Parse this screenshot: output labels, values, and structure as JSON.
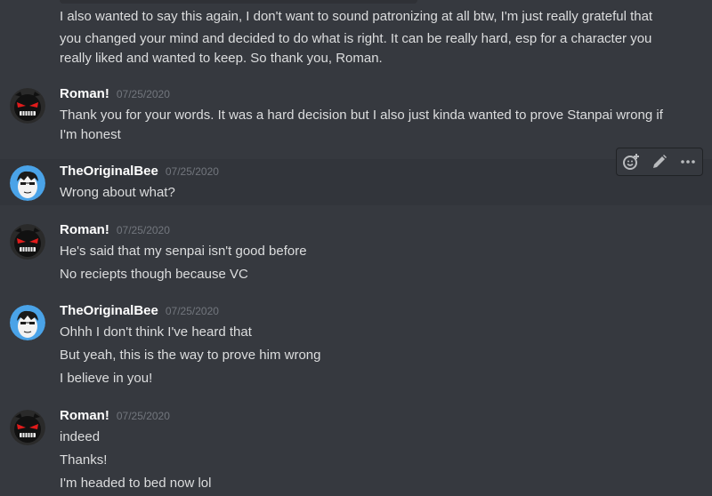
{
  "continuation_lines": [
    "I also wanted to say this again, I don't want to sound patronizing at all btw, I'm just really grateful that",
    "you changed your mind and decided to do what is right. It can be really hard, esp for a character you",
    "really liked and wanted to keep. So thank you, Roman."
  ],
  "messages": [
    {
      "author": "Roman!",
      "timestamp": "07/25/2020",
      "lines": [
        "Thank you for your words. It was a hard decision but I also just kinda wanted to prove Stanpai wrong if",
        "I'm honest"
      ]
    },
    {
      "author": "TheOriginalBee",
      "timestamp": "07/25/2020",
      "lines": [
        "Wrong about what?"
      ]
    },
    {
      "author": "Roman!",
      "timestamp": "07/25/2020",
      "lines": [
        "He's said that my senpai isn't good before",
        "No reciepts though because VC"
      ]
    },
    {
      "author": "TheOriginalBee",
      "timestamp": "07/25/2020",
      "lines": [
        "Ohhh I don't think I've heard that",
        "But yeah, this is the way to prove him wrong",
        "I believe in you!"
      ]
    },
    {
      "author": "Roman!",
      "timestamp": "07/25/2020",
      "lines": [
        "indeed",
        "Thanks!",
        "I'm headed to bed now lol"
      ]
    }
  ],
  "toolbar": {
    "icons": [
      "add-reaction-icon",
      "edit-icon",
      "more-icon"
    ]
  },
  "colors": {
    "background": "#36393f",
    "hover_background": "#32353b",
    "username": "#ffffff",
    "timestamp": "#72767d",
    "text": "#dcddde",
    "bee_avatar": "#4aa3e8",
    "roman_avatar_eyes": "#e01b1b"
  }
}
